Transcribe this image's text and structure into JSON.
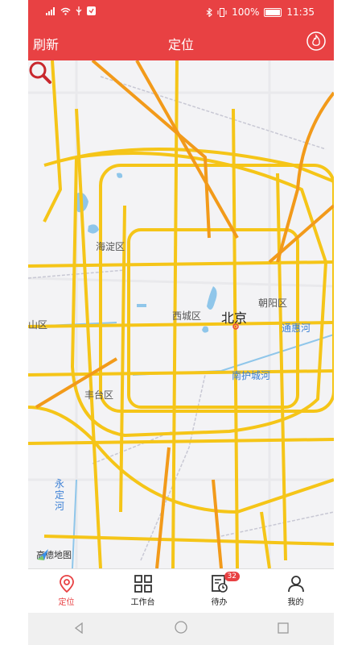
{
  "status_bar": {
    "battery": "100%",
    "time": "11:35"
  },
  "header": {
    "refresh_label": "刷新",
    "title": "定位"
  },
  "map": {
    "labels": {
      "city": "北京",
      "haidian": "海淀区",
      "chaoyang": "朝阳区",
      "xicheng": "西城区",
      "shijingshan": "山区",
      "fengtai": "丰台区",
      "tonghui": "通惠河",
      "nanhu": "南护城河",
      "yongding": "永定河"
    },
    "logo_text": "高德地图"
  },
  "tabs": [
    {
      "label": "定位",
      "icon": "location-pin-icon",
      "active": true
    },
    {
      "label": "工作台",
      "icon": "grid-icon",
      "active": false
    },
    {
      "label": "待办",
      "icon": "todo-icon",
      "active": false,
      "badge": "32"
    },
    {
      "label": "我的",
      "icon": "person-icon",
      "active": false
    }
  ],
  "colors": {
    "accent": "#e84143",
    "road_major": "#f5c518",
    "road_highway": "#f29a1a",
    "water": "#8fc6ea"
  }
}
